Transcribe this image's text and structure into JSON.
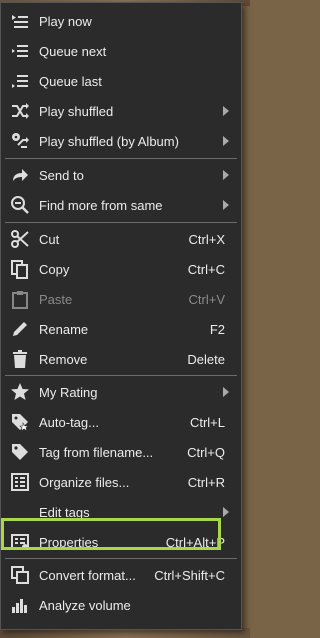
{
  "menu": {
    "items": [
      {
        "label": "Play now",
        "icon": "play-list-icon"
      },
      {
        "label": "Queue next",
        "icon": "queue-next-icon"
      },
      {
        "label": "Queue last",
        "icon": "queue-last-icon"
      },
      {
        "label": "Play shuffled",
        "icon": "shuffle-icon",
        "submenu": true
      },
      {
        "label": "Play shuffled (by Album)",
        "icon": "shuffle-album-icon",
        "submenu": true
      },
      {
        "label": "Send to",
        "icon": "send-icon",
        "submenu": true
      },
      {
        "label": "Find more from same",
        "icon": "find-icon",
        "submenu": true
      },
      {
        "label": "Cut",
        "shortcut": "Ctrl+X",
        "icon": "scissors-icon"
      },
      {
        "label": "Copy",
        "shortcut": "Ctrl+C",
        "icon": "copy-icon"
      },
      {
        "label": "Paste",
        "shortcut": "Ctrl+V",
        "icon": "paste-icon",
        "disabled": true
      },
      {
        "label": "Rename",
        "shortcut": "F2",
        "icon": "pencil-icon"
      },
      {
        "label": "Remove",
        "shortcut": "Delete",
        "icon": "trash-icon"
      },
      {
        "label": "My Rating",
        "icon": "star-icon",
        "submenu": true
      },
      {
        "label": "Auto-tag...",
        "shortcut": "Ctrl+L",
        "icon": "auto-tag-icon"
      },
      {
        "label": "Tag from filename...",
        "shortcut": "Ctrl+Q",
        "icon": "tag-icon"
      },
      {
        "label": "Organize files...",
        "shortcut": "Ctrl+R",
        "icon": "organize-icon"
      },
      {
        "label": "Edit tags",
        "icon": "edit-tags-icon",
        "submenu": true
      },
      {
        "label": "Properties",
        "shortcut": "Ctrl+Alt+P",
        "icon": "properties-icon",
        "highlighted": true
      },
      {
        "label": "Convert format...",
        "shortcut": "Ctrl+Shift+C",
        "icon": "convert-icon"
      },
      {
        "label": "Analyze volume",
        "icon": "analyze-volume-icon"
      }
    ]
  },
  "colors": {
    "menu_background": "#2b2b2b",
    "text": "#ececec",
    "disabled_text": "#8a8a8a",
    "highlight_border": "#a8d84a"
  }
}
